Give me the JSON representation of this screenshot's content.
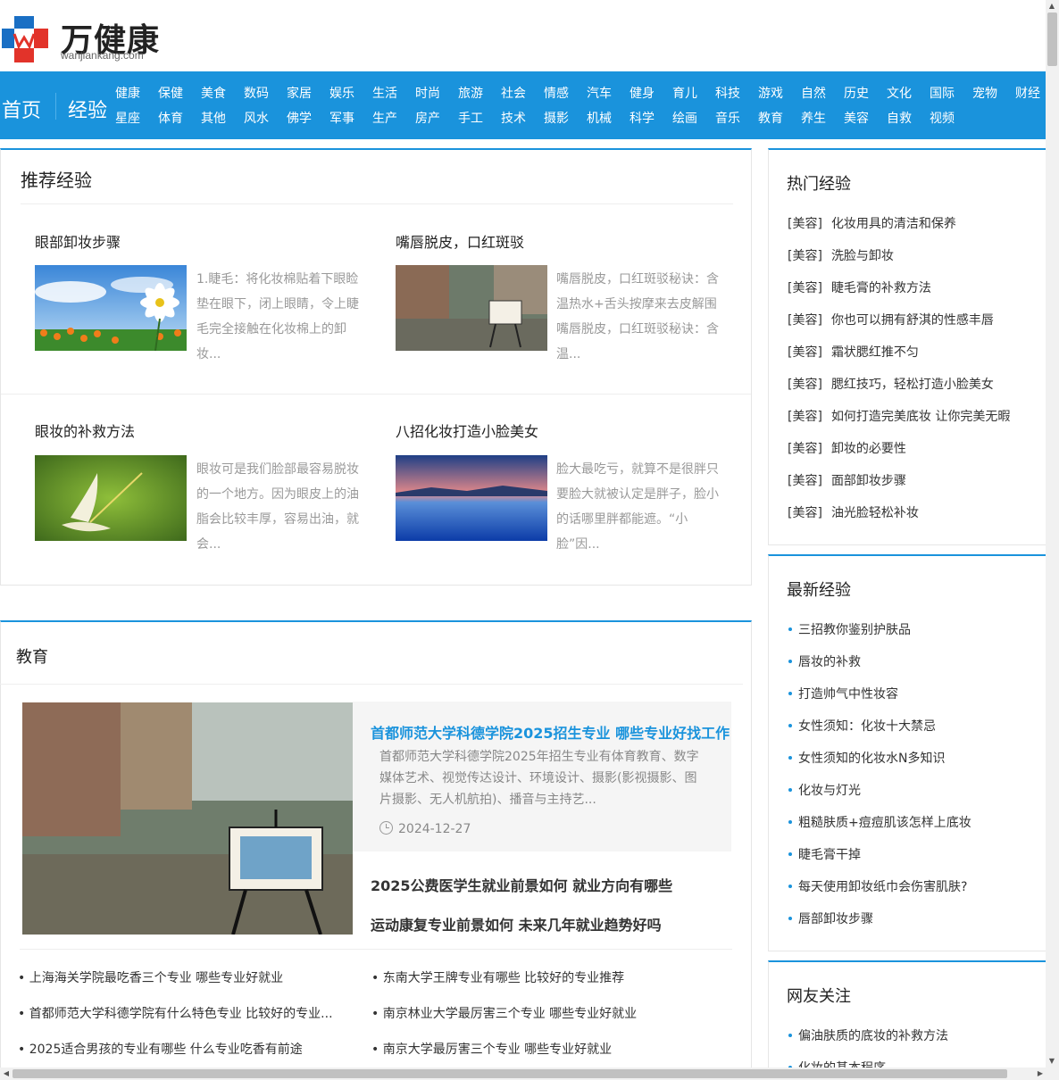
{
  "logo": {
    "name": "万健康",
    "domain": "wanjiankang.com"
  },
  "nav": {
    "home": "首页",
    "experience": "经验",
    "row1": [
      "健康",
      "保健",
      "美食",
      "数码",
      "家居",
      "娱乐",
      "生活",
      "时尚",
      "旅游",
      "社会",
      "情感",
      "汽车",
      "健身",
      "育儿",
      "科技",
      "游戏",
      "自然",
      "历史",
      "文化",
      "国际",
      "宠物",
      "财经"
    ],
    "row2": [
      "星座",
      "体育",
      "其他",
      "风水",
      "佛学",
      "军事",
      "生产",
      "房产",
      "手工",
      "技术",
      "摄影",
      "机械",
      "科学",
      "绘画",
      "音乐",
      "教育",
      "养生",
      "美容",
      "自救",
      "视频"
    ]
  },
  "recommend": {
    "title": "推荐经验",
    "cards": [
      {
        "title": "眼部卸妆步骤",
        "desc": "1.睫毛：将化妆棉贴着下眼睑垫在眼下，闭上眼睛，令上睫毛完全接触在化妆棉上的卸妆..."
      },
      {
        "title": "嘴唇脱皮，口红斑驳",
        "desc": "嘴唇脱皮，口红斑驳秘诀：含温热水+舌头按摩来去皮解围嘴唇脱皮，口红斑驳秘诀：含温..."
      },
      {
        "title": "眼妆的补救方法",
        "desc": "眼妆可是我们脸部最容易脱妆的一个地方。因为眼皮上的油脂会比较丰厚，容易出油，就会..."
      },
      {
        "title": "八招化妆打造小脸美女",
        "desc": "脸大最吃亏，就算不是很胖只要脸大就被认定是胖子，脸小的话哪里胖都能遮。“小脸”因..."
      }
    ]
  },
  "education": {
    "title": "教育",
    "feature": {
      "title": "首都师范大学科德学院2025招生专业 哪些专业好找工作",
      "desc": "首都师范大学科德学院2025年招生专业有体育教育、数字媒体艺术、视觉传达设计、环境设计、摄影(影视摄影、图片摄影、无人机航拍)、播音与主持艺...",
      "date": "2024-12-27"
    },
    "headlines": [
      "2025公费医学生就业前景如何 就业方向有哪些",
      "运动康复专业前景如何 未来几年就业趋势好吗"
    ],
    "links_left": [
      "上海海关学院最吃香三个专业 哪些专业好就业",
      "首都师范大学科德学院有什么特色专业 比较好的专业...",
      "2025适合男孩的专业有哪些 什么专业吃香有前途"
    ],
    "links_right": [
      "东南大学王牌专业有哪些 比较好的专业推荐",
      "南京林业大学最厉害三个专业 哪些专业好就业",
      "南京大学最厉害三个专业 哪些专业好就业"
    ]
  },
  "hot": {
    "title": "热门经验",
    "tag": "[美容]",
    "items": [
      "化妆用具的清洁和保养",
      "洗脸与卸妆",
      "睫毛膏的补救方法",
      "你也可以拥有舒淇的性感丰唇",
      "霜状腮红推不匀",
      "腮红技巧，轻松打造小脸美女",
      "如何打造完美底妆 让你完美无暇",
      "卸妆的必要性",
      "面部卸妆步骤",
      "油光脸轻松补妆"
    ]
  },
  "latest": {
    "title": "最新经验",
    "items": [
      "三招教你鉴别护肤品",
      "唇妆的补救",
      "打造帅气中性妆容",
      "女性须知：化妆十大禁忌",
      "女性须知的化妆水N多知识",
      "化妆与灯光",
      "粗糙肤质+痘痘肌该怎样上底妆",
      "睫毛膏干掉",
      "每天使用卸妆纸巾会伤害肌肤?",
      "唇部卸妆步骤"
    ]
  },
  "fans": {
    "title": "网友关注",
    "items": [
      "偏油肤质的底妆的补救方法",
      "化妆的基本程序"
    ]
  },
  "colors": {
    "accent": "#1a93dc",
    "logo_red": "#e2332a",
    "logo_blue": "#1a6fc4"
  }
}
